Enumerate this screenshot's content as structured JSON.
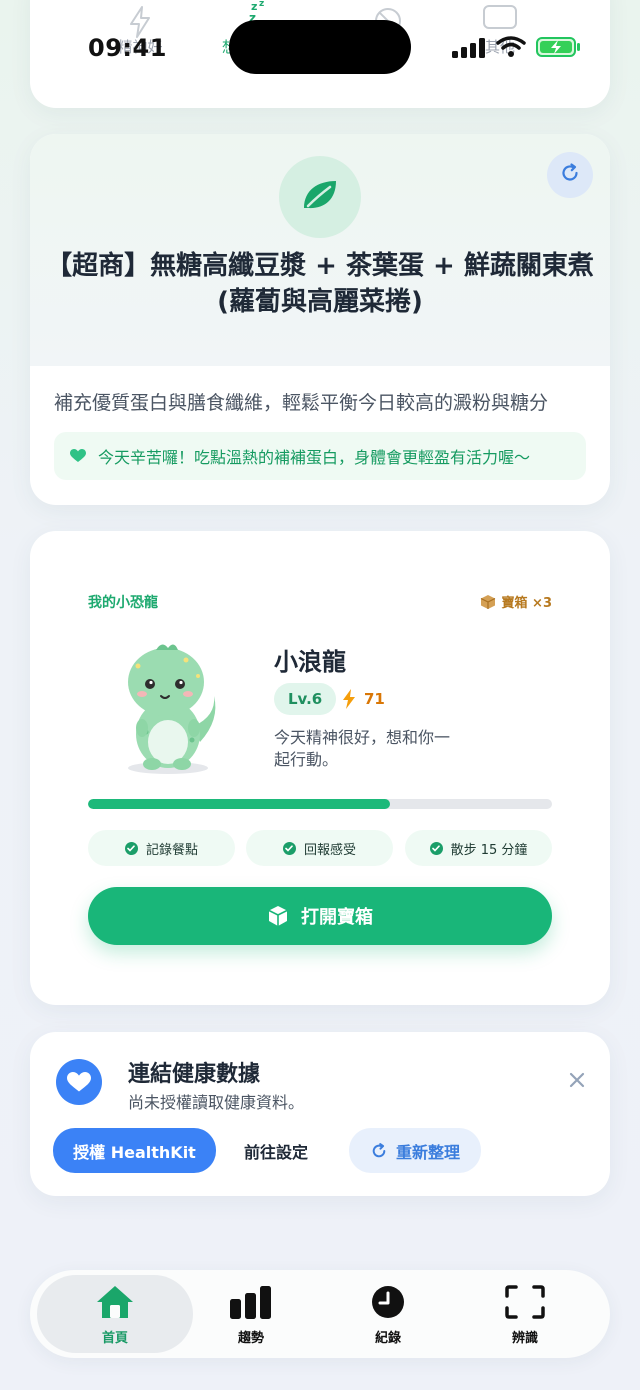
{
  "status_bar": {
    "time": "09:41"
  },
  "mood": {
    "items": [
      {
        "label": "精神好",
        "icon": "lightning-icon"
      },
      {
        "label": "想睡",
        "icon": "sleep-icon"
      },
      {
        "label": "",
        "icon": "no-symbol-icon"
      },
      {
        "label": "其他",
        "icon": "chat-bubble-icon"
      }
    ]
  },
  "meal": {
    "title_line1": "【超商】無糖高纖豆漿 + 茶葉蛋 + 鮮蔬關東煮",
    "title_line2": "(蘿蔔與高麗菜捲)",
    "description": "補充優質蛋白與膳食纖維，輕鬆平衡今日較高的澱粉與糖分",
    "tip": "今天辛苦囉！吃點溫熱的補補蛋白，身體會更輕盈有活力喔～"
  },
  "dino": {
    "section_label": "我的小恐龍",
    "chest_label": "寶箱 ×3",
    "name": "小浪龍",
    "level": "Lv.6",
    "energy": "71",
    "message": "今天精神很好，想和你一起行動。",
    "progress": 0.65,
    "tasks": [
      "記錄餐點",
      "回報感受",
      "散步 15 分鐘"
    ],
    "open_chest_label": "打開寶箱"
  },
  "health": {
    "title": "連結健康數據",
    "subtitle": "尚未授權讀取健康資料。",
    "authorize_label": "授權 HealthKit",
    "settings_label": "前往設定",
    "reload_label": "重新整理"
  },
  "nav": {
    "items": [
      {
        "label": "首頁",
        "icon": "home-icon",
        "active": true
      },
      {
        "label": "趨勢",
        "icon": "bar-chart-icon",
        "active": false
      },
      {
        "label": "紀錄",
        "icon": "clock-icon",
        "active": false
      },
      {
        "label": "辨識",
        "icon": "scan-icon",
        "active": false
      }
    ]
  },
  "colors": {
    "accent_green": "#19b679",
    "accent_blue": "#3b82f6",
    "chest_gold": "#b7791f"
  }
}
